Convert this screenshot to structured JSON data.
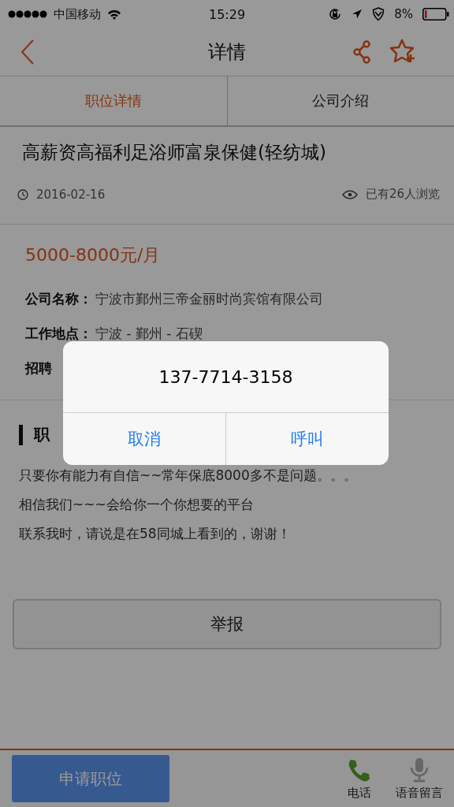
{
  "status_bar": {
    "carrier": "中国移动",
    "time": "15:29",
    "battery_percent": "8%"
  },
  "nav": {
    "title": "详情"
  },
  "tabs": [
    {
      "label": "职位详情",
      "selected": true
    },
    {
      "label": "公司介绍",
      "selected": false
    }
  ],
  "job": {
    "title": "高薪资高福利足浴师富泉保健(轻纺城)",
    "date": "2016-02-16",
    "views": "已有26人浏览",
    "salary": "5000-8000元/月",
    "fields": [
      {
        "label": "公司名称：",
        "value": "宁波市鄞州三帝金丽时尚宾馆有限公司"
      },
      {
        "label": "工作地点：",
        "value": "宁波 - 鄞州 - 石碶"
      },
      {
        "label": "招聘"
      }
    ]
  },
  "section": {
    "heading": "职",
    "lines": [
      "只要你有能力有自信~~常年保底8000多不是问题。。。",
      "相信我们~~~会给你一个你想要的平台",
      "联系我时，请说是在58同城上看到的，谢谢！"
    ]
  },
  "report_button": "举报",
  "bottom_bar": {
    "apply_button": "申请职位",
    "actions": [
      {
        "kind": "phone",
        "label": "电话"
      },
      {
        "kind": "voice",
        "label": "语音留言"
      }
    ]
  },
  "dialog": {
    "message": "137-7714-3158",
    "buttons": [
      "取消",
      "呼叫"
    ]
  }
}
